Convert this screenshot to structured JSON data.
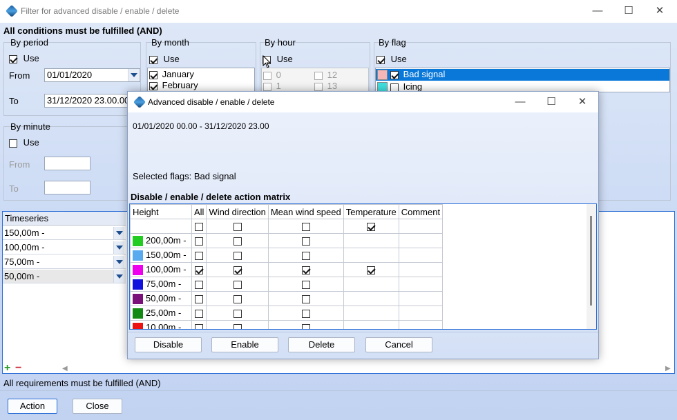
{
  "main": {
    "title": "Filter for advanced disable / enable / delete",
    "heading": "All conditions must be fulfilled (AND)",
    "period": {
      "label": "By period",
      "use": "Use",
      "use_checked": true,
      "from_label": "From",
      "from_value": "01/01/2020",
      "to_label": "To",
      "to_value": "31/12/2020 23.00.00"
    },
    "minute": {
      "label": "By minute",
      "use": "Use",
      "use_checked": false,
      "from_label": "From",
      "to_label": "To"
    },
    "month": {
      "label": "By month",
      "use": "Use",
      "items": [
        "January",
        "February"
      ]
    },
    "hour": {
      "label": "By hour",
      "use": "Use",
      "items": [
        "0",
        "12",
        "1",
        "13"
      ]
    },
    "flag": {
      "label": "By flag",
      "use": "Use",
      "items": [
        {
          "name": "Bad signal",
          "color": "#f4b6b6"
        },
        {
          "name": "Icing",
          "color": "#40e0e0"
        }
      ]
    },
    "timeseries": {
      "header": "Timeseries",
      "rows": [
        "150,00m -",
        "100,00m -",
        "75,00m -",
        "50,00m -"
      ]
    },
    "status": "All requirements must be fulfilled (AND)",
    "action_button": "Action",
    "close_button": "Close"
  },
  "dialog": {
    "title": "Advanced disable / enable / delete",
    "period_text": "01/01/2020 00.00 - 31/12/2020 23.00",
    "flags_text": "Selected flags: Bad signal",
    "matrix_title": "Disable / enable / delete action matrix",
    "columns": [
      "Height",
      "All",
      "Wind direction",
      "Mean wind speed",
      "Temperature",
      "Comment"
    ],
    "rows": [
      {
        "height": "",
        "color": "",
        "all": false,
        "wind_dir": false,
        "mean_wind": false,
        "temp": true
      },
      {
        "height": "200,00m -",
        "color": "#22cc22",
        "all": false,
        "wind_dir": false,
        "mean_wind": false,
        "temp": null
      },
      {
        "height": "150,00m -",
        "color": "#5aaaf0",
        "all": false,
        "wind_dir": false,
        "mean_wind": false,
        "temp": null
      },
      {
        "height": "100,00m -",
        "color": "#ee00ee",
        "all": true,
        "wind_dir": true,
        "mean_wind": true,
        "temp": true
      },
      {
        "height": "75,00m -",
        "color": "#1111dd",
        "all": false,
        "wind_dir": false,
        "mean_wind": false,
        "temp": null
      },
      {
        "height": "50,00m -",
        "color": "#7a107a",
        "all": false,
        "wind_dir": false,
        "mean_wind": false,
        "temp": null
      },
      {
        "height": "25,00m -",
        "color": "#138a13",
        "all": false,
        "wind_dir": false,
        "mean_wind": false,
        "temp": null
      },
      {
        "height": "10,00m -",
        "color": "#ee1111",
        "all": false,
        "wind_dir": false,
        "mean_wind": false,
        "temp": null
      }
    ],
    "buttons": {
      "disable": "Disable",
      "enable": "Enable",
      "delete": "Delete",
      "cancel": "Cancel"
    }
  }
}
